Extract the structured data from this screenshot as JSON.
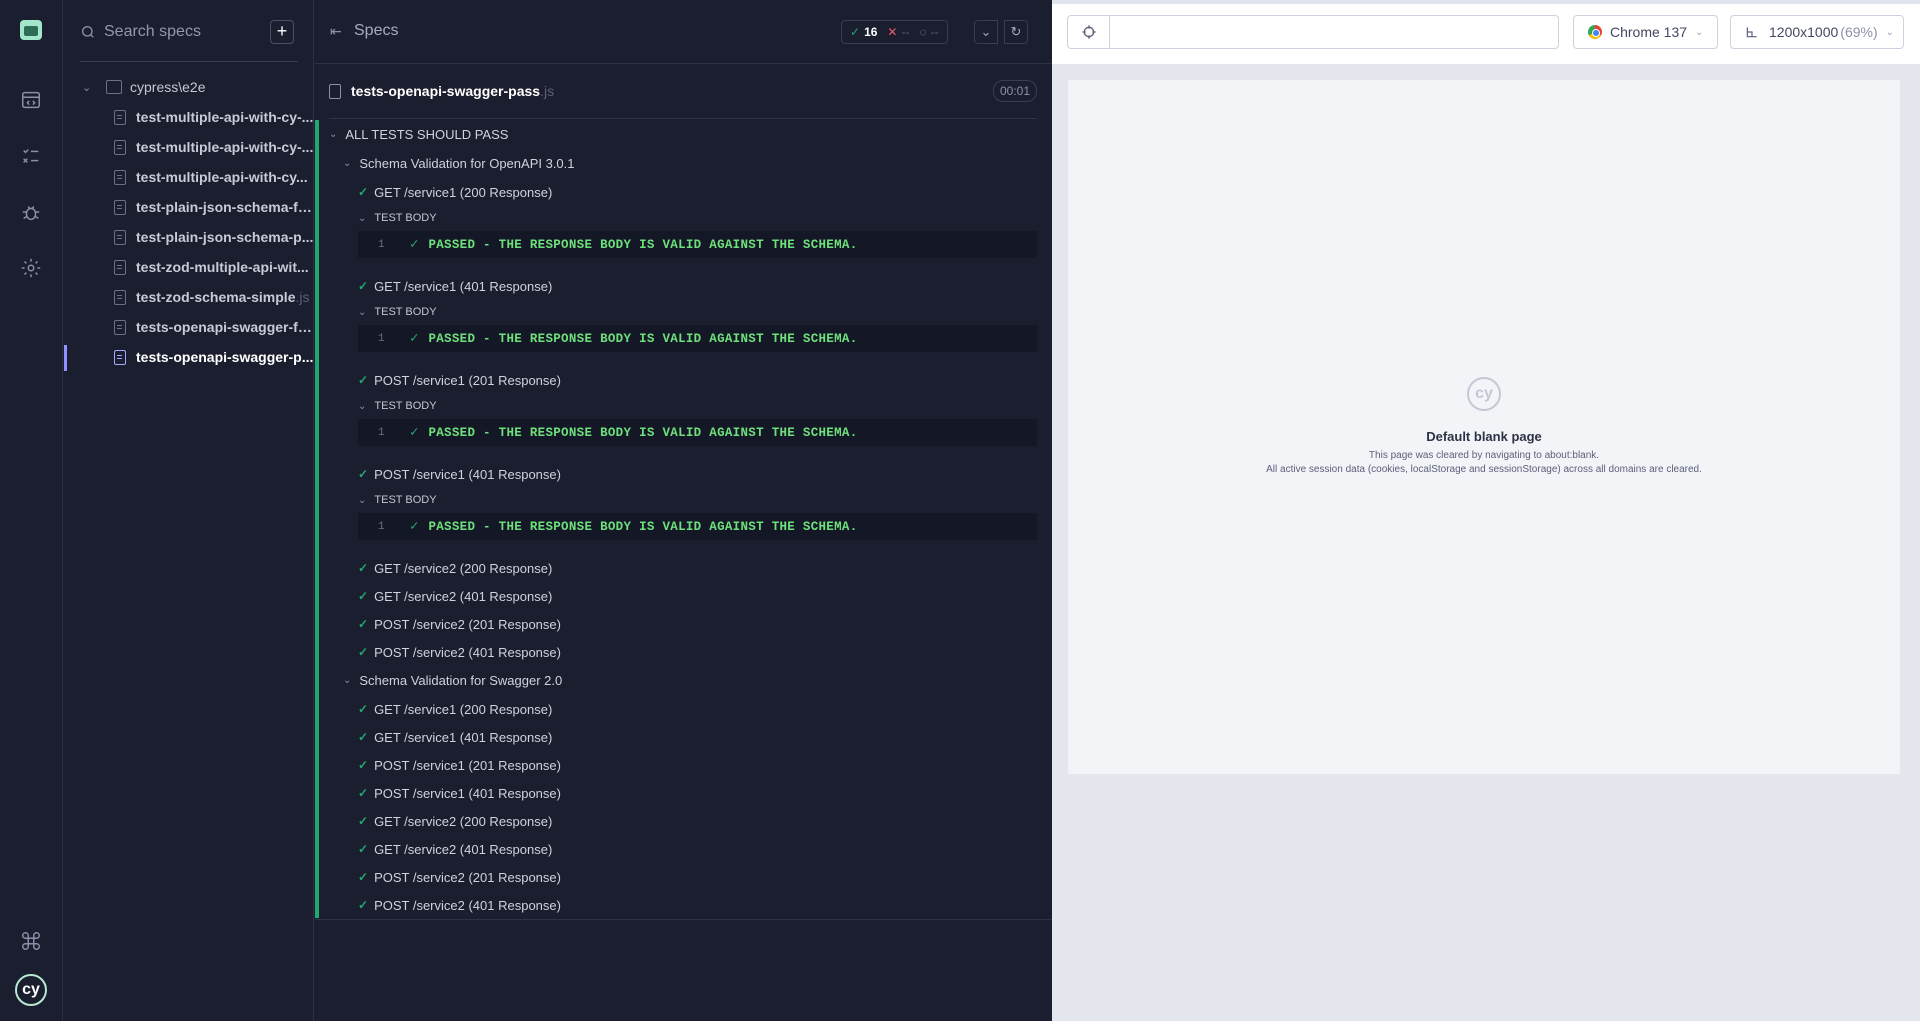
{
  "sidebar": {
    "search_placeholder": "Search specs",
    "add_label": "+",
    "folder": "cypress\\e2e",
    "files": [
      {
        "name": "test-multiple-api-with-cy-...",
        "ext": ""
      },
      {
        "name": "test-multiple-api-with-cy-...",
        "ext": ""
      },
      {
        "name": "test-multiple-api-with-cy...",
        "ext": ""
      },
      {
        "name": "test-plain-json-schema-fa...",
        "ext": ""
      },
      {
        "name": "test-plain-json-schema-p...",
        "ext": ""
      },
      {
        "name": "test-zod-multiple-api-wit...",
        "ext": ""
      },
      {
        "name": "test-zod-schema-simple",
        "ext": ".js"
      },
      {
        "name": "tests-openapi-swagger-fa...",
        "ext": ""
      },
      {
        "name": "tests-openapi-swagger-p...",
        "ext": ""
      }
    ]
  },
  "reporter": {
    "specs_label": "Specs",
    "stats": {
      "passed": "16",
      "failed": "--",
      "pending": "--"
    },
    "spec_file": "tests-openapi-swagger-pass",
    "spec_ext": ".js",
    "duration": "00:01",
    "suite_title": "ALL TESTS SHOULD PASS",
    "body_label": "TEST BODY",
    "cmd_num": "1",
    "cmd_msg": "PASSED - THE RESPONSE BODY IS VALID AGAINST THE SCHEMA.",
    "groups": [
      {
        "title": "Schema Validation for OpenAPI 3.0.1",
        "tests": [
          "GET /service1 (200 Response)",
          "GET /service1 (401 Response)",
          "POST /service1 (201 Response)",
          "POST /service1 (401 Response)",
          "GET /service2 (200 Response)",
          "GET /service2 (401 Response)",
          "POST /service2 (201 Response)",
          "POST /service2 (401 Response)"
        ]
      },
      {
        "title": "Schema Validation for Swagger 2.0",
        "tests": [
          "GET /service1 (200 Response)",
          "GET /service1 (401 Response)",
          "POST /service1 (201 Response)",
          "POST /service1 (401 Response)",
          "GET /service2 (200 Response)",
          "GET /service2 (401 Response)",
          "POST /service2 (201 Response)",
          "POST /service2 (401 Response)"
        ]
      }
    ]
  },
  "preview": {
    "url": "",
    "browser": "Chrome 137",
    "viewport": "1200x1000",
    "zoom": "(69%)",
    "blank_title": "Default blank page",
    "blank_line1": "This page was cleared by navigating to about:blank.",
    "blank_line2": "All active session data (cookies, localStorage and sessionStorage) across all domains are cleared."
  },
  "colors": {
    "pass": "#1fa971",
    "accent": "#8f91ff",
    "bg": "#1b1e2e"
  }
}
